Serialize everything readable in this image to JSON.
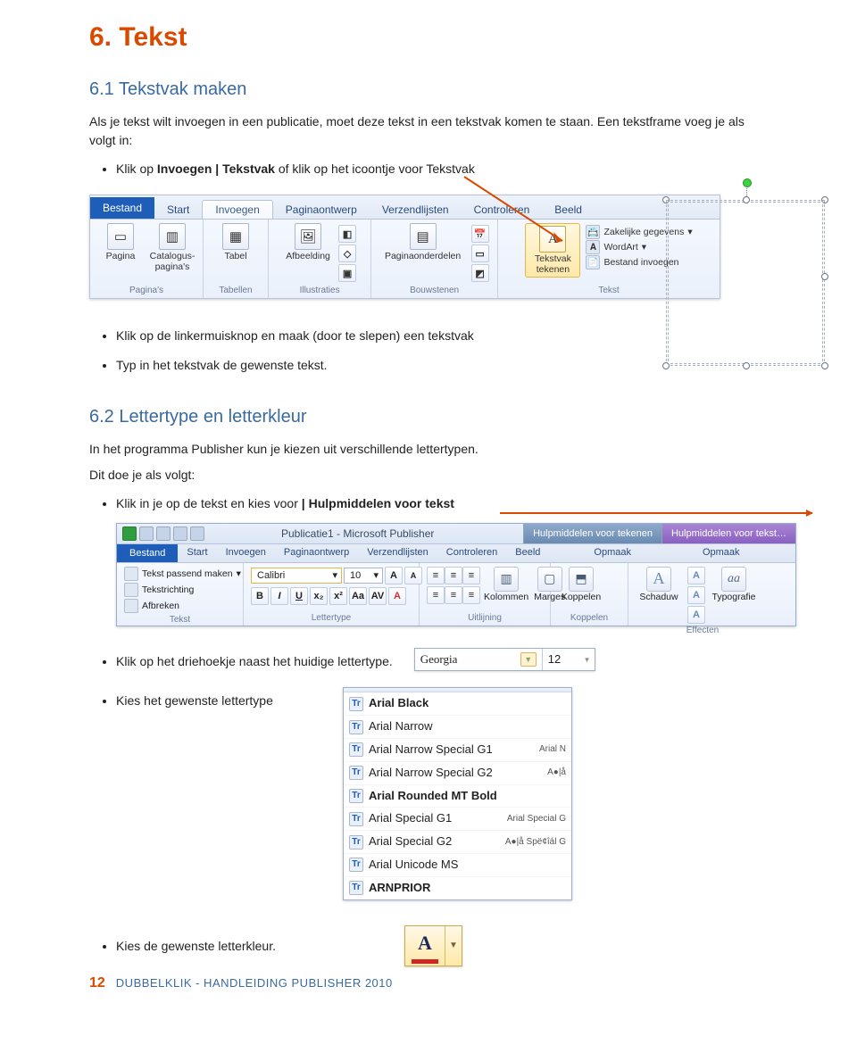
{
  "title": "6. Tekst",
  "section_6_1": {
    "heading": "6.1 Tekstvak maken",
    "intro1": "Als je tekst wilt invoegen in een publicatie, moet deze tekst in een tekstvak komen te staan. Een tekstframe voeg je als volgt in:",
    "bullet1_a": "Klik op ",
    "bullet1_b": "Invoegen | Tekstvak",
    "bullet1_c": " of klik op het icoontje voor Tekstvak",
    "bullet2": "Klik op de linkermuisknop en maak (door te slepen) een tekstvak",
    "bullet3": "Typ in het tekstvak de gewenste tekst."
  },
  "ribbon1": {
    "tabs": {
      "bestand": "Bestand",
      "start": "Start",
      "invoegen": "Invoegen",
      "pagina": "Paginaontwerp",
      "verzend": "Verzendlijsten",
      "controleren": "Controleren",
      "beeld": "Beeld"
    },
    "groups": {
      "paginas": {
        "label": "Pagina's",
        "btn1": "Pagina",
        "btn2": "Catalogus-\npagina's"
      },
      "tabellen": {
        "label": "Tabellen",
        "btn": "Tabel"
      },
      "illustraties": {
        "label": "Illustraties",
        "btn": "Afbeelding"
      },
      "bouwstenen": {
        "label": "Bouwstenen",
        "btn": "Paginaonderdelen"
      },
      "tekst": {
        "label": "Tekst",
        "btn1": "Tekstvak\ntekenen",
        "mini1": "Zakelijke gegevens",
        "mini2": "WordArt",
        "mini3": "Bestand invoegen"
      }
    }
  },
  "section_6_2": {
    "heading": "6.2 Lettertype en letterkleur",
    "intro": "In het programma Publisher kun je kiezen uit verschillende lettertypen.",
    "dit": "Dit doe je als volgt:",
    "bullet1_a": "Klik in je op de tekst en kies voor ",
    "bullet1_b": "| Hulpmiddelen voor tekst",
    "bullet2": "Klik op het driehoekje naast het huidige lettertype.",
    "bullet3": "Kies het gewenste lettertype",
    "bullet4": "Kies de gewenste letterkleur."
  },
  "ribbon2": {
    "title": "Publicatie1  -  Microsoft Publisher",
    "ctx_draw": "Hulpmiddelen voor tekenen",
    "ctx_text": "Hulpmiddelen voor tekst…",
    "tabs": {
      "bestand": "Bestand",
      "start": "Start",
      "invoegen": "Invoegen",
      "pagina": "Paginaontwerp",
      "verzend": "Verzendlijsten",
      "controleren": "Controleren",
      "beeld": "Beeld",
      "opmaak": "Opmaak"
    },
    "groups": {
      "tekst": {
        "label": "Tekst",
        "k1": "Tekst passend maken",
        "k2": "Tekstrichting",
        "k3": "Afbreken"
      },
      "lettertype": {
        "label": "Lettertype",
        "font": "Calibri",
        "size": "10"
      },
      "uitlijning": {
        "label": "Uitlijning",
        "b1": "Kolommen",
        "b2": "Marges"
      },
      "koppelen": {
        "label": "Koppelen",
        "b": "Koppelen"
      },
      "effecten": {
        "label": "Effecten",
        "b1": "Schaduw",
        "b2": "Typografie",
        "aa": "aa"
      }
    }
  },
  "font_selector": {
    "font": "Georgia",
    "size": "12"
  },
  "font_list": [
    {
      "name": "Arial Black",
      "bold": true,
      "sample": ""
    },
    {
      "name": "Arial Narrow",
      "bold": false,
      "sample": ""
    },
    {
      "name": "Arial Narrow Special G1",
      "bold": false,
      "sample": "Arial N"
    },
    {
      "name": "Arial Narrow Special G2",
      "bold": false,
      "sample": "A●|å"
    },
    {
      "name": "Arial Rounded MT Bold",
      "bold": true,
      "sample": ""
    },
    {
      "name": "Arial Special G1",
      "bold": false,
      "sample": "Arial Special G"
    },
    {
      "name": "Arial Special G2",
      "bold": false,
      "sample": "A●|å Spë¢îál G"
    },
    {
      "name": "Arial Unicode MS",
      "bold": false,
      "sample": ""
    },
    {
      "name": "ARNPRIOR",
      "bold": true,
      "sample": ""
    }
  ],
  "color_chooser": {
    "letter": "A"
  },
  "footer": {
    "page": "12",
    "text": "DUBBELKLIK  -  HANDLEIDING PUBLISHER 2010"
  }
}
